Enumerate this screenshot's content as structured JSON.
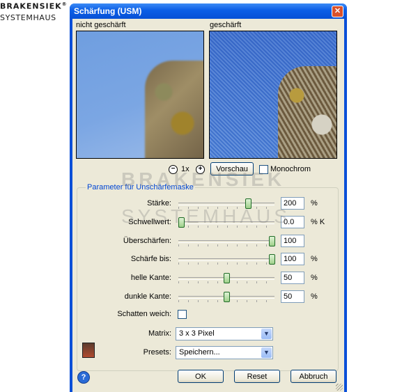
{
  "brand": {
    "line1": "BRAKENSIEK",
    "reg": "®",
    "line2": "SYSTEMHAUS"
  },
  "dialog": {
    "title": "Schärfung (USM)",
    "close_glyph": "✕",
    "preview_before_label": "nicht geschärft",
    "preview_after_label": "geschärft",
    "zoom": {
      "out_glyph": "−",
      "value": "1x",
      "in_glyph": "+"
    },
    "preview_button": "Vorschau",
    "monochrome_label": "Monochrom",
    "monochrome_checked": false,
    "group_title": "Parameter für Unschärfemaske",
    "params": [
      {
        "label": "Stärke:",
        "value": "200",
        "unit": "%",
        "fraction": 0.74
      },
      {
        "label": "Schwellwert:",
        "value": "0.0",
        "unit": "% K",
        "fraction": 0.0
      },
      {
        "label": "Überschärfen:",
        "value": "100",
        "unit": "",
        "fraction": 1.0
      },
      {
        "label": "Schärfe bis:",
        "value": "100",
        "unit": "%",
        "fraction": 1.0
      },
      {
        "label": "helle Kante:",
        "value": "50",
        "unit": "%",
        "fraction": 0.5
      },
      {
        "label": "dunkle Kante:",
        "value": "50",
        "unit": "%",
        "fraction": 0.5
      }
    ],
    "soft_shadow_label": "Schatten weich:",
    "soft_shadow_checked": false,
    "matrix_label": "Matrix:",
    "matrix_value": "3 x 3 Pixel",
    "presets_label": "Presets:",
    "presets_value": "Speichern...",
    "ok_button": "OK",
    "reset_button": "Reset",
    "cancel_button": "Abbruch",
    "help_glyph": "?"
  },
  "watermark": {
    "line1": "BRAKENSIEK",
    "line2": "SYSTEMHAUS"
  }
}
